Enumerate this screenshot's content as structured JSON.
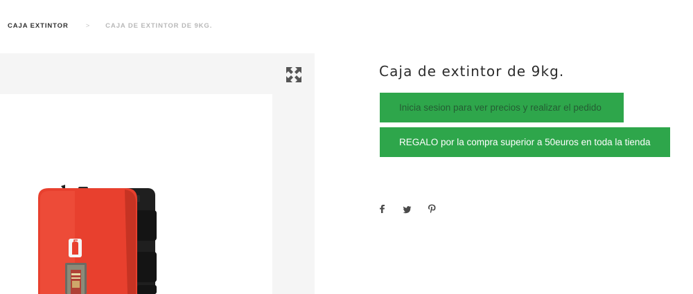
{
  "breadcrumb": {
    "parent": "CAJA EXTINTOR",
    "separator": ">",
    "current": "CAJA DE EXTINTOR DE 9KG."
  },
  "gallery": {
    "zoom_icon": "expand-arrows-icon",
    "product_image": "red fire extinguisher cabinet with black side hinges and window"
  },
  "product": {
    "title": "Caja de extintor de 9kg.",
    "login_button": "Inicia sesion para ver precios y realizar el pedido",
    "gift_button": "REGALO por la compra superior a 50euros en toda la tienda"
  },
  "share": {
    "icons": [
      "facebook-icon",
      "twitter-icon",
      "pinterest-icon"
    ]
  },
  "colors": {
    "button_green": "#2ea64b",
    "login_text": "#245d33",
    "gallery_bg": "#f5f5f5",
    "cabinet_red": "#e8402e"
  }
}
